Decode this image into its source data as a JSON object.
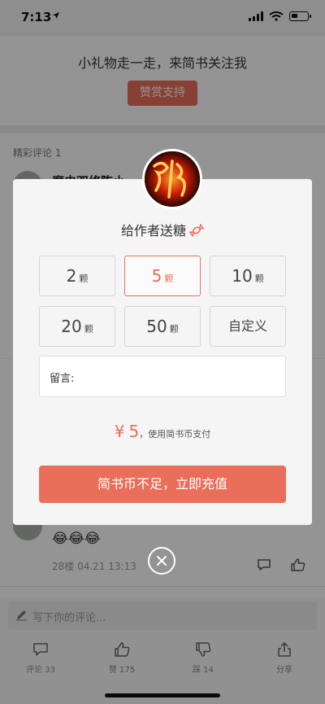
{
  "status_bar": {
    "time": "7:13",
    "location_arrow": "location-arrow-icon"
  },
  "reward": {
    "text": "小礼物走一走，来简书关注我",
    "button": "赞赏支持"
  },
  "comments": {
    "title": "精彩评论 1",
    "commenter_name": "魔史双修陈小",
    "emojis": "😂😂😂",
    "floor_meta": "28楼 04.21 13:13"
  },
  "bottom": {
    "write_placeholder": "写下你的评论...",
    "actions": [
      {
        "label": "评论 33",
        "icon": "comment-icon"
      },
      {
        "label": "赞 175",
        "icon": "thumbs-up-icon"
      },
      {
        "label": "踩 14",
        "icon": "thumbs-down-icon"
      },
      {
        "label": "分享",
        "icon": "share-icon"
      }
    ]
  },
  "modal": {
    "title": "给作者送糖",
    "options": [
      {
        "num": "2",
        "unit": "颗"
      },
      {
        "num": "5",
        "unit": "颗",
        "selected": true
      },
      {
        "num": "10",
        "unit": "颗"
      },
      {
        "num": "20",
        "unit": "颗"
      },
      {
        "num": "50",
        "unit": "颗"
      }
    ],
    "custom_label": "自定义",
    "message_label": "留言:",
    "currency": "¥",
    "amount": "5",
    "payment_note": "，使用简书币支付",
    "recharge_button": "简书币不足，立即充值"
  },
  "colors": {
    "accent": "#ea6f5a",
    "overlay": "rgba(0,0,0,0.42)"
  }
}
